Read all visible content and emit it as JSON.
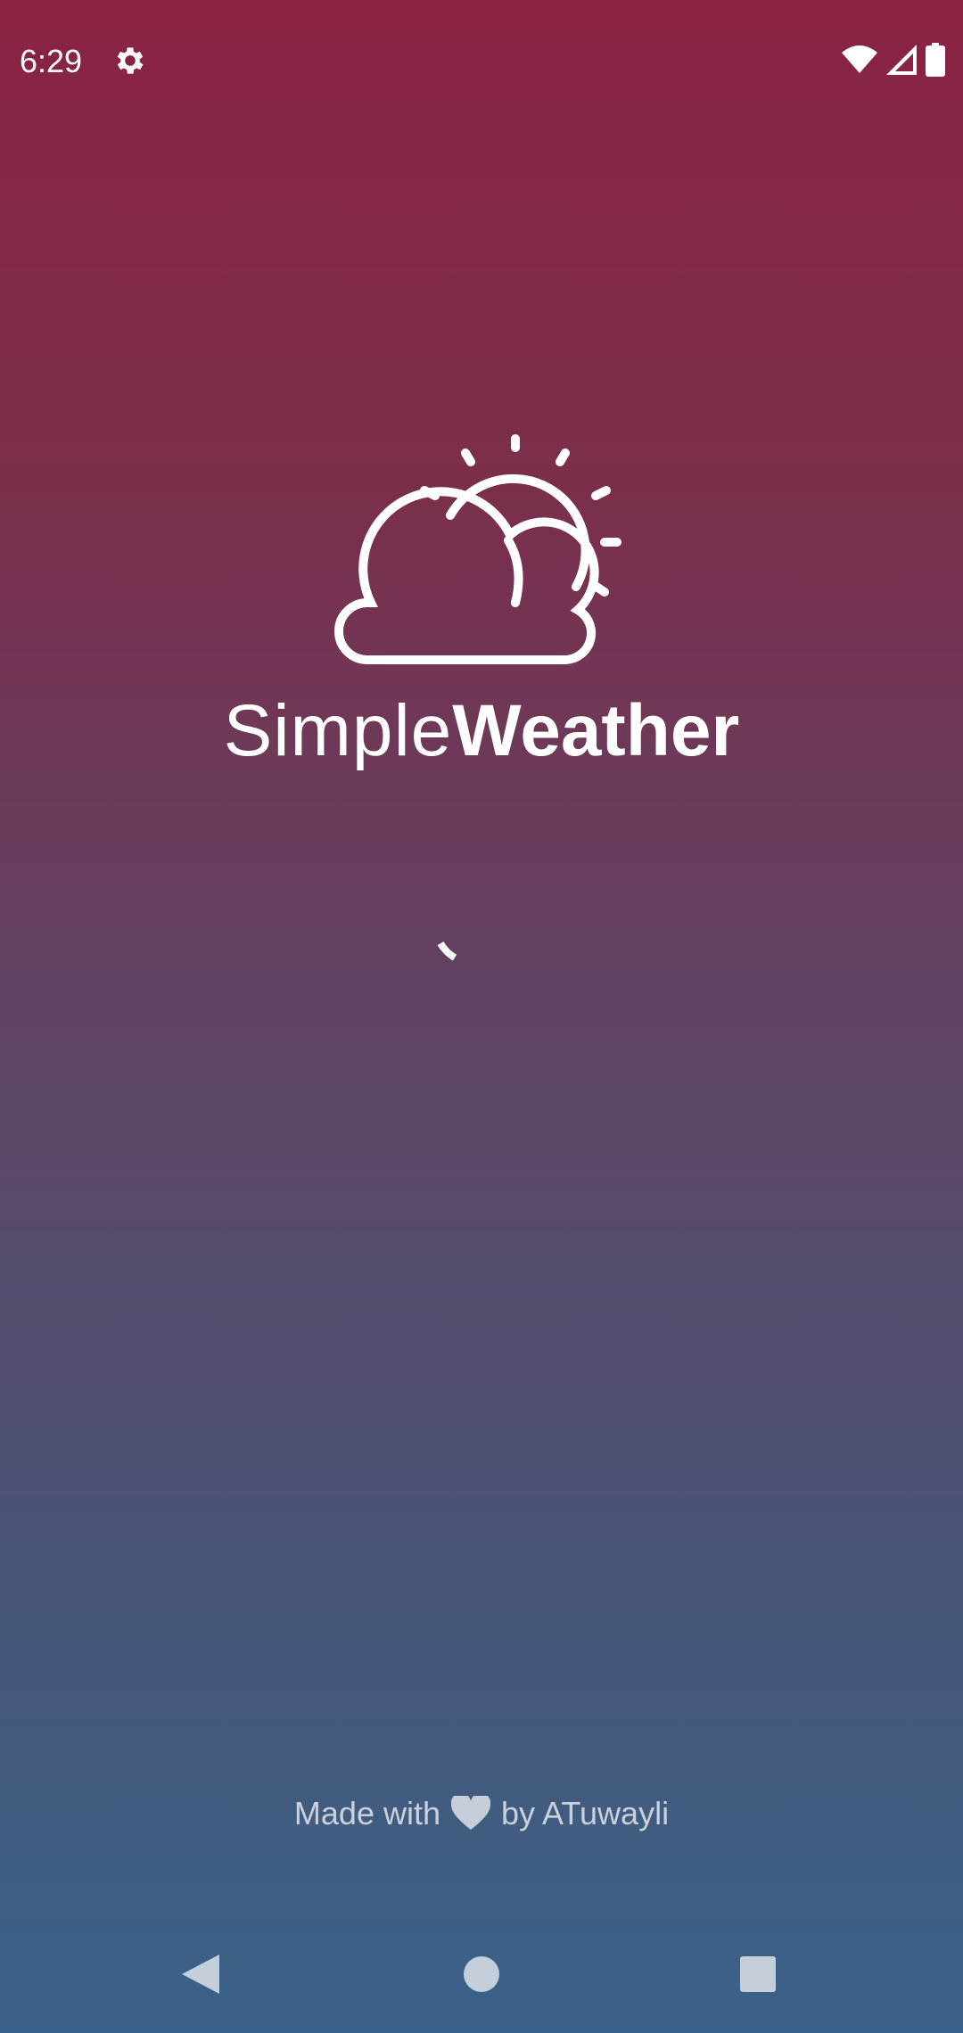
{
  "status_bar": {
    "time": "6:29",
    "icons": [
      "gear-icon",
      "wifi-icon",
      "cellular-signal-icon",
      "battery-icon"
    ]
  },
  "logo": {
    "icon": "sun-behind-cloud-icon",
    "text_light": "Simple",
    "text_bold": "Weather"
  },
  "loading": {
    "icon": "loading-spinner-icon"
  },
  "footer": {
    "made_with": "Made with",
    "heart_icon": "heart-icon",
    "by_author": "by ATuwayli"
  },
  "nav_bar": {
    "buttons": [
      "back-icon",
      "home-icon",
      "recents-icon"
    ]
  },
  "colors": {
    "gradient_top": "#8a2340",
    "gradient_bottom": "#3a6189",
    "text": "#ffffff"
  }
}
